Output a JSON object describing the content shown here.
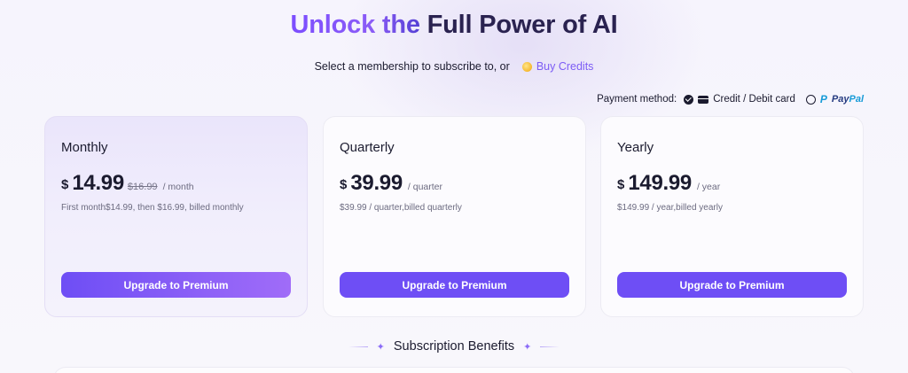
{
  "header": {
    "title_part1": "Unlock the ",
    "title_part2": "Full Power of AI",
    "subtitle": "Select a membership to subscribe to, or",
    "buy_credits_label": "Buy Credits"
  },
  "payment": {
    "label": "Payment method:",
    "options": [
      {
        "label": "Credit / Debit card",
        "selected": true
      },
      {
        "label_part1": "Pay",
        "label_part2": "Pal",
        "selected": false
      }
    ]
  },
  "plans": [
    {
      "name": "Monthly",
      "currency": "$",
      "price": "14.99",
      "old_price": "$16.99",
      "period": "/ month",
      "note": "First month$14.99, then $16.99, billed monthly",
      "cta": "Upgrade to Premium"
    },
    {
      "name": "Quarterly",
      "currency": "$",
      "price": "39.99",
      "period": "/ quarter",
      "note": "$39.99 / quarter,billed quarterly",
      "cta": "Upgrade to Premium"
    },
    {
      "name": "Yearly",
      "currency": "$",
      "price": "149.99",
      "period": "/ year",
      "note": "$149.99 / year,billed yearly",
      "cta": "Upgrade to Premium"
    }
  ],
  "benefits": {
    "title": "Subscription Benefits"
  },
  "colors": {
    "accent": "#6e4ef5",
    "accent_light": "#a06cf8",
    "link": "#7c5cf5"
  }
}
